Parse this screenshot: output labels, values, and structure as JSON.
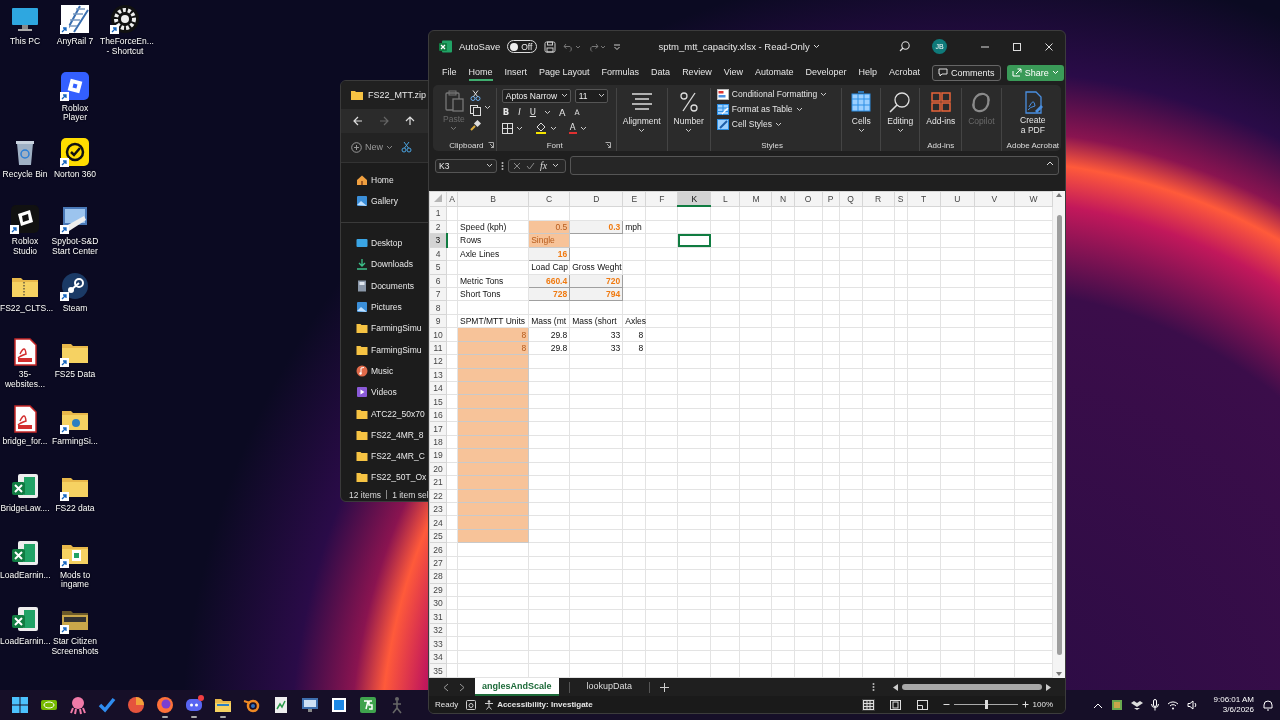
{
  "desktop_icons": [
    {
      "kind": "monitor",
      "label": "This PC",
      "shortcut": false
    },
    {
      "kind": "rail",
      "label": "AnyRail 7",
      "shortcut": true
    },
    {
      "kind": "gear",
      "label": "TheForceEn... - Shortcut",
      "shortcut": true
    },
    {
      "kind": "roblox",
      "label": "Roblox Player",
      "shortcut": true
    },
    {
      "kind": "recycle",
      "label": "Recycle Bin",
      "shortcut": false
    },
    {
      "kind": "norton",
      "label": "Norton 360",
      "shortcut": true
    },
    {
      "kind": "studio",
      "label": "Roblox Studio",
      "shortcut": true
    },
    {
      "kind": "spybot",
      "label": "Spybot-S&D Start Center",
      "shortcut": true
    },
    {
      "kind": "zip",
      "label": "FS22_CLTS...",
      "shortcut": false
    },
    {
      "kind": "steam",
      "label": "Steam",
      "shortcut": true
    },
    {
      "kind": "pdf",
      "label": "35-websites...",
      "shortcut": false
    },
    {
      "kind": "folder",
      "label": "FS25 Data",
      "shortcut": true
    },
    {
      "kind": "pdf",
      "label": "bridge_for...",
      "shortcut": false
    },
    {
      "kind": "folderdisc",
      "label": "FarmingSi...",
      "shortcut": true
    },
    {
      "kind": "excel",
      "label": "BridgeLaw....",
      "shortcut": false
    },
    {
      "kind": "folder",
      "label": "FS22 data",
      "shortcut": true
    },
    {
      "kind": "excel",
      "label": "LoadEarnin...",
      "shortcut": false
    },
    {
      "kind": "folderdoc",
      "label": "Mods to ingame",
      "shortcut": true
    },
    {
      "kind": "excel",
      "label": "LoadEarnin...",
      "shortcut": false
    },
    {
      "kind": "folderdark",
      "label": "Star Citizen Screenshots",
      "shortcut": true
    }
  ],
  "explorer": {
    "title": "FS22_MTT.zip",
    "new_label": "New",
    "nav": [
      {
        "kind": "home",
        "label": "Home"
      },
      {
        "kind": "gallery",
        "label": "Gallery"
      },
      {
        "kind": "desktop",
        "label": "Desktop"
      },
      {
        "kind": "downloads",
        "label": "Downloads"
      },
      {
        "kind": "documents",
        "label": "Documents"
      },
      {
        "kind": "pictures",
        "label": "Pictures"
      },
      {
        "kind": "folder",
        "label": "FarmingSimu"
      },
      {
        "kind": "folder",
        "label": "FarmingSimu"
      },
      {
        "kind": "music",
        "label": "Music"
      },
      {
        "kind": "videos",
        "label": "Videos"
      },
      {
        "kind": "folder",
        "label": "ATC22_50x70"
      },
      {
        "kind": "folder",
        "label": "FS22_4MR_8"
      },
      {
        "kind": "folder",
        "label": "FS22_4MR_C"
      },
      {
        "kind": "folder",
        "label": "FS22_50T_Ox"
      }
    ],
    "status": [
      "12 items",
      "1 item sel"
    ]
  },
  "excel": {
    "title_bar": {
      "autosave_label": "AutoSave",
      "autosave": {
        "label": "Off",
        "on": false
      },
      "file_title": "sptm_mtt_capacity.xlsx - Read-Only",
      "avatar": "JB"
    },
    "menu": {
      "tabs": [
        {
          "label": "File",
          "selected": false
        },
        {
          "label": "Home",
          "selected": true
        },
        {
          "label": "Insert",
          "selected": false
        },
        {
          "label": "Page Layout",
          "selected": false
        },
        {
          "label": "Formulas",
          "selected": false
        },
        {
          "label": "Data",
          "selected": false
        },
        {
          "label": "Review",
          "selected": false
        },
        {
          "label": "View",
          "selected": false
        },
        {
          "label": "Automate",
          "selected": false
        },
        {
          "label": "Developer",
          "selected": false
        },
        {
          "label": "Help",
          "selected": false
        },
        {
          "label": "Acrobat",
          "selected": false
        }
      ],
      "comments": "Comments",
      "share": "Share"
    },
    "ribbon": {
      "groups": [
        {
          "kind": "clipboard",
          "title": "Clipboard",
          "paste": {
            "label": "Paste",
            "disabled": true
          }
        },
        {
          "kind": "font",
          "title": "Font",
          "font_name": "Aptos Narrow",
          "font_size": "11",
          "bold": "B",
          "italic": "I",
          "underline": "U",
          "grow": "A",
          "shrink": "A",
          "font_color": "A"
        },
        {
          "kind": "buttons",
          "buttons": [
            {
              "kind": "alignment",
              "label": "Alignment",
              "dropdown": true,
              "disabled": false
            }
          ]
        },
        {
          "kind": "buttons",
          "buttons": [
            {
              "kind": "number",
              "label": "Number",
              "dropdown": true,
              "disabled": false
            }
          ]
        },
        {
          "kind": "styles",
          "title": "Styles",
          "items": [
            {
              "kind": "conditional",
              "label": "Conditional Formatting"
            },
            {
              "kind": "table",
              "label": "Format as Table"
            },
            {
              "kind": "cellstyles",
              "label": "Cell Styles"
            }
          ]
        },
        {
          "kind": "buttons",
          "buttons": [
            {
              "kind": "cells",
              "label": "Cells",
              "dropdown": true,
              "disabled": false
            }
          ]
        },
        {
          "kind": "buttons",
          "buttons": [
            {
              "kind": "editing",
              "label": "Editing",
              "dropdown": true,
              "disabled": false
            }
          ]
        },
        {
          "kind": "buttons",
          "title": "Add-ins",
          "buttons": [
            {
              "kind": "addins",
              "label": "Add-ins",
              "dropdown": false,
              "disabled": false
            }
          ]
        },
        {
          "kind": "buttons",
          "buttons": [
            {
              "kind": "copilot",
              "label": "Copilot",
              "dropdown": false,
              "disabled": true
            }
          ]
        },
        {
          "kind": "buttons",
          "title": "Adobe Acrobat",
          "buttons": [
            {
              "kind": "pdf",
              "label": "Create a PDF",
              "dropdown": false,
              "disabled": false
            }
          ]
        }
      ]
    },
    "formula_bar": {
      "name_box": "K3",
      "function_label": "fx"
    },
    "sheet": {
      "columns": [
        {
          "label": "A",
          "selected": false
        },
        {
          "label": "B",
          "selected": false
        },
        {
          "label": "C",
          "selected": false
        },
        {
          "label": "D",
          "selected": false
        },
        {
          "label": "E",
          "selected": false
        },
        {
          "label": "F",
          "selected": false
        },
        {
          "label": "K",
          "selected": true
        },
        {
          "label": "L",
          "selected": false
        },
        {
          "label": "M",
          "selected": false
        },
        {
          "label": "N",
          "selected": false
        },
        {
          "label": "O",
          "selected": false
        },
        {
          "label": "P",
          "selected": false
        },
        {
          "label": "Q",
          "selected": false
        },
        {
          "label": "R",
          "selected": false
        },
        {
          "label": "S",
          "selected": false
        },
        {
          "label": "T",
          "selected": false
        },
        {
          "label": "U",
          "selected": false
        },
        {
          "label": "V",
          "selected": false
        },
        {
          "label": "W",
          "selected": false
        }
      ],
      "rows": [
        {
          "number": "1",
          "selected": false
        },
        {
          "number": "2",
          "selected": false,
          "cells": [
            {},
            {
              "text": "Speed (kph)",
              "numeric": false
            },
            {
              "text": "0.5",
              "numeric": true,
              "kind": "input"
            },
            {
              "text": "0.3",
              "numeric": true,
              "kind": "output"
            },
            {
              "text": "mph",
              "numeric": false
            }
          ]
        },
        {
          "number": "3",
          "selected": true,
          "cells": [
            {},
            {
              "text": "Rows",
              "numeric": false
            },
            {
              "text": "Single",
              "numeric": false,
              "kind": "input"
            }
          ]
        },
        {
          "number": "4",
          "selected": false,
          "cells": [
            {},
            {
              "text": "Axle Lines",
              "numeric": false
            },
            {
              "text": "16",
              "numeric": true,
              "kind": "output"
            }
          ]
        },
        {
          "number": "5",
          "selected": false,
          "cells": [
            {},
            {},
            {
              "text": "Load Cap",
              "numeric": false
            },
            {
              "text": "Gross Weght",
              "numeric": false
            }
          ]
        },
        {
          "number": "6",
          "selected": false,
          "cells": [
            {},
            {
              "text": "Metric Tons",
              "numeric": false
            },
            {
              "text": "660.4",
              "numeric": true,
              "kind": "output"
            },
            {
              "text": "720",
              "numeric": true,
              "kind": "output"
            }
          ]
        },
        {
          "number": "7",
          "selected": false,
          "cells": [
            {},
            {
              "text": "Short Tons",
              "numeric": false
            },
            {
              "text": "728",
              "numeric": true,
              "kind": "output"
            },
            {
              "text": "794",
              "numeric": true,
              "kind": "output"
            }
          ]
        },
        {
          "number": "8",
          "selected": false
        },
        {
          "number": "9",
          "selected": false,
          "cells": [
            {},
            {
              "text": "SPMT/MTT Units",
              "numeric": false
            },
            {
              "text": "Mass (mt",
              "numeric": false
            },
            {
              "text": "Mass (short",
              "numeric": false
            },
            {
              "text": "Axles",
              "numeric": false
            }
          ]
        },
        {
          "number": "10",
          "selected": false,
          "cells": [
            {},
            {
              "text": "8",
              "numeric": true,
              "kind": "input"
            },
            {
              "text": "29.8",
              "numeric": true
            },
            {
              "text": "33",
              "numeric": true
            },
            {
              "text": "8",
              "numeric": true
            }
          ]
        },
        {
          "number": "11",
          "selected": false,
          "cells": [
            {},
            {
              "text": "8",
              "numeric": true,
              "kind": "input"
            },
            {
              "text": "29.8",
              "numeric": true
            },
            {
              "text": "33",
              "numeric": true
            },
            {
              "text": "8",
              "numeric": true
            }
          ]
        },
        {
          "number": "12",
          "selected": false,
          "cells": [
            {},
            {
              "kind": "input"
            }
          ]
        },
        {
          "number": "13",
          "selected": false,
          "cells": [
            {},
            {
              "kind": "input"
            }
          ]
        },
        {
          "number": "14",
          "selected": false,
          "cells": [
            {},
            {
              "kind": "input"
            }
          ]
        },
        {
          "number": "15",
          "selected": false,
          "cells": [
            {},
            {
              "kind": "input"
            }
          ]
        },
        {
          "number": "16",
          "selected": false,
          "cells": [
            {},
            {
              "kind": "input"
            }
          ]
        },
        {
          "number": "17",
          "selected": false,
          "cells": [
            {},
            {
              "kind": "input"
            }
          ]
        },
        {
          "number": "18",
          "selected": false,
          "cells": [
            {},
            {
              "kind": "input"
            }
          ]
        },
        {
          "number": "19",
          "selected": false,
          "cells": [
            {},
            {
              "kind": "input"
            }
          ]
        },
        {
          "number": "20",
          "selected": false,
          "cells": [
            {},
            {
              "kind": "input"
            }
          ]
        },
        {
          "number": "21",
          "selected": false,
          "cells": [
            {},
            {
              "kind": "input"
            }
          ]
        },
        {
          "number": "22",
          "selected": false,
          "cells": [
            {},
            {
              "kind": "input"
            }
          ]
        },
        {
          "number": "23",
          "selected": false,
          "cells": [
            {},
            {
              "kind": "input"
            }
          ]
        },
        {
          "number": "24",
          "selected": false,
          "cells": [
            {},
            {
              "kind": "input"
            }
          ]
        },
        {
          "number": "25",
          "selected": false,
          "cells": [
            {},
            {
              "kind": "input"
            }
          ]
        },
        {
          "number": "26",
          "selected": false
        },
        {
          "number": "27",
          "selected": false
        },
        {
          "number": "28",
          "selected": false
        },
        {
          "number": "29",
          "selected": false
        },
        {
          "number": "30",
          "selected": false
        },
        {
          "number": "31",
          "selected": false
        },
        {
          "number": "32",
          "selected": false
        },
        {
          "number": "33",
          "selected": false
        },
        {
          "number": "34",
          "selected": false
        },
        {
          "number": "35",
          "selected": false
        }
      ]
    },
    "sheet_tabs": [
      {
        "label": "anglesAndScale",
        "selected": true
      },
      {
        "label": "lookupData",
        "selected": false
      }
    ],
    "status_bar": {
      "mode": "Ready",
      "accessibility": "Accessibility: Investigate",
      "views": [
        {
          "kind": "normal",
          "selected": true
        },
        {
          "kind": "layout",
          "selected": false
        },
        {
          "kind": "break",
          "selected": false
        }
      ],
      "zoom": {
        "level": 0.5,
        "label": "100%"
      }
    }
  },
  "taskbar": {
    "apps": [
      {
        "kind": "start",
        "running": false,
        "notification": false
      },
      {
        "kind": "nvidia",
        "running": false,
        "notification": false
      },
      {
        "kind": "octopus",
        "running": false,
        "notification": false
      },
      {
        "kind": "check",
        "running": false,
        "notification": false
      },
      {
        "kind": "red",
        "running": false,
        "notification": false
      },
      {
        "kind": "firefox",
        "running": true,
        "notification": false
      },
      {
        "kind": "discord",
        "running": true,
        "notification": true
      },
      {
        "kind": "explorer",
        "running": true,
        "notification": false
      },
      {
        "kind": "blender",
        "running": false,
        "notification": false
      },
      {
        "kind": "sheet",
        "running": false,
        "notification": false
      },
      {
        "kind": "screen",
        "running": false,
        "notification": false
      },
      {
        "kind": "square",
        "running": false,
        "notification": false
      },
      {
        "kind": "tile",
        "running": false,
        "notification": false
      },
      {
        "kind": "figure",
        "running": false,
        "notification": false
      }
    ],
    "clock": {
      "time": "9:06:01 AM",
      "date": "3/6/2026"
    }
  }
}
